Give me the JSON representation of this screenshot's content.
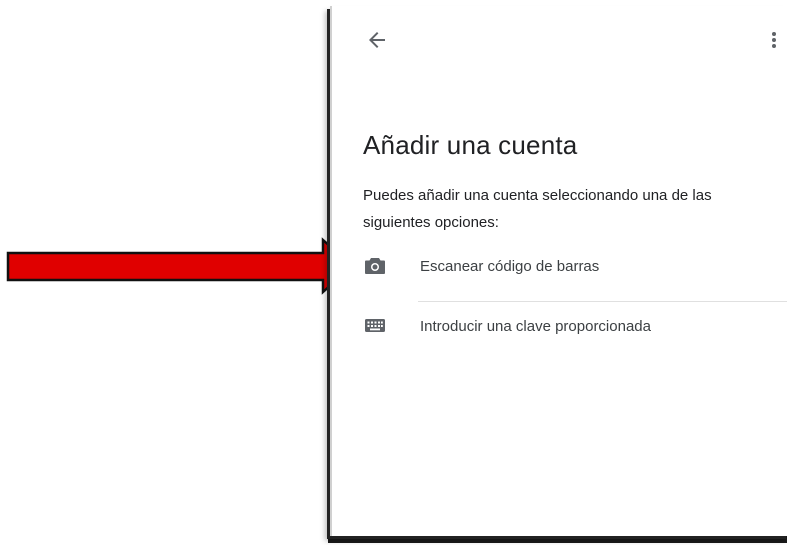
{
  "header": {
    "back_icon": "arrow-left-icon",
    "more_icon": "more-vertical-icon"
  },
  "page": {
    "title": "Añadir una cuenta",
    "subtitle": "Puedes añadir una cuenta seleccionando una de las siguientes opciones:"
  },
  "options": [
    {
      "label": "Escanear código de barras",
      "icon": "camera-icon"
    },
    {
      "label": "Introducir una clave proporcionada",
      "icon": "keyboard-icon"
    }
  ],
  "annotation": {
    "arrow_color": "#e00000"
  }
}
